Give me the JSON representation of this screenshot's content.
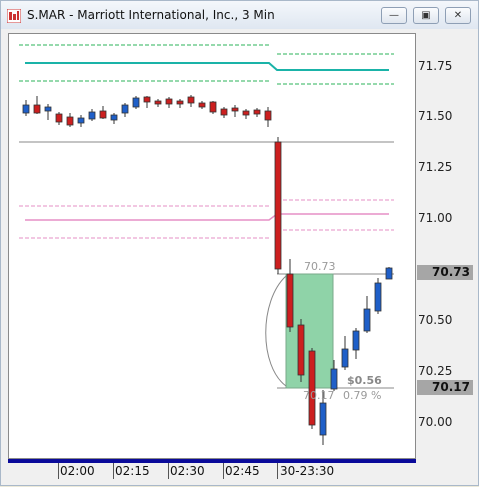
{
  "window": {
    "title": "S.MAR - Marriott International, Inc., 3 Min",
    "buttons": {
      "minimize": "—",
      "restore": "▣",
      "close": "✕"
    }
  },
  "price_axis": {
    "labels": [
      "71.75",
      "71.50",
      "71.25",
      "71.00",
      "70.50",
      "70.25",
      "70.00"
    ],
    "tag_current": "70.73",
    "tag_low": "70.17"
  },
  "time_axis": {
    "labels": [
      "02:00",
      "02:15",
      "02:30",
      "02:45",
      "30-23:30"
    ]
  },
  "annotations": {
    "top_price": "70.73",
    "profit": "$0.56",
    "entry_price": "70.17",
    "percent": "0.79 %"
  },
  "colors": {
    "up_candle": "#1f5fc8",
    "down_candle": "#cc1f1f",
    "teal_line": "#1ab3a8",
    "green_dash": "#2bb35a",
    "pink_line": "#e58fc5",
    "grey_line": "#8a8a8a",
    "highlight": "#8fd3a8",
    "axis_bar": "#0a0a9a"
  }
}
